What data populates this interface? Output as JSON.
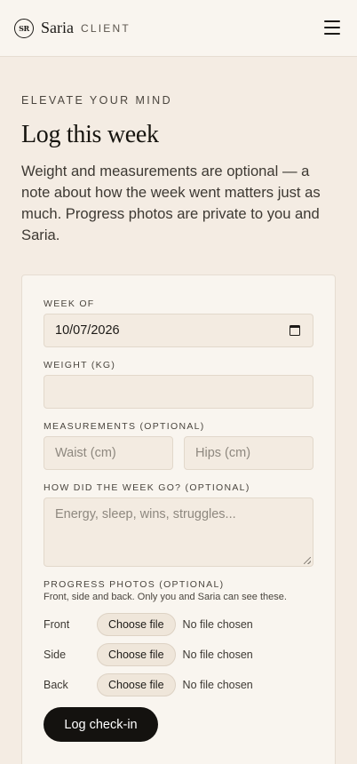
{
  "header": {
    "logo_mark": "SR",
    "brand_name": "Saria",
    "brand_sub": "CLIENT"
  },
  "page": {
    "eyebrow": "ELEVATE YOUR MIND",
    "title": "Log this week",
    "intro": "Weight and measurements are optional — a note about how the week went matters just as much. Progress photos are private to you and Saria."
  },
  "form": {
    "week_of": {
      "label": "WEEK OF",
      "value": "10/07/2026"
    },
    "weight": {
      "label": "WEIGHT (KG)",
      "value": ""
    },
    "measurements": {
      "label": "MEASUREMENTS (OPTIONAL)",
      "waist_placeholder": "Waist (cm)",
      "hips_placeholder": "Hips (cm)"
    },
    "notes": {
      "label": "HOW DID THE WEEK GO? (OPTIONAL)",
      "placeholder": "Energy, sleep, wins, struggles..."
    },
    "photos": {
      "label": "PROGRESS PHOTOS (OPTIONAL)",
      "hint": "Front, side and back. Only you and Saria can see these.",
      "items": [
        {
          "label": "Front",
          "button": "Choose file",
          "status": "No file chosen"
        },
        {
          "label": "Side",
          "button": "Choose file",
          "status": "No file chosen"
        },
        {
          "label": "Back",
          "button": "Choose file",
          "status": "No file chosen"
        }
      ]
    },
    "submit_label": "Log check-in"
  }
}
